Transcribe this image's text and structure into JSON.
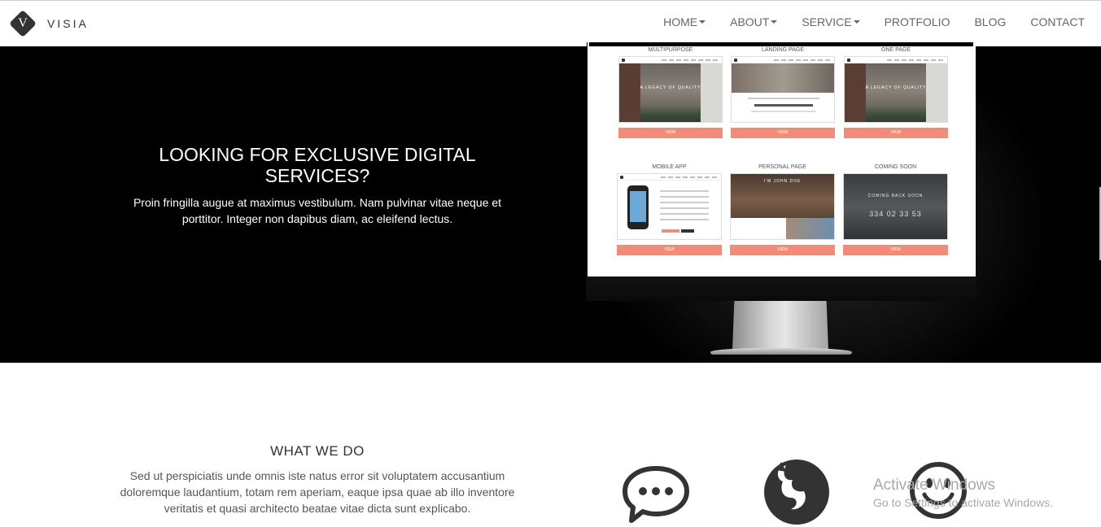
{
  "logo": {
    "letter": "V",
    "text": "VISIA"
  },
  "nav": {
    "items": [
      {
        "label": "HOME",
        "dropdown": true
      },
      {
        "label": "ABOUT",
        "dropdown": true
      },
      {
        "label": "SERVICE",
        "dropdown": true
      },
      {
        "label": "PROTFOLIO",
        "dropdown": false
      },
      {
        "label": "BLOG",
        "dropdown": false
      },
      {
        "label": "CONTACT",
        "dropdown": false
      }
    ]
  },
  "hero": {
    "title": "LOOKING FOR EXCLUSIVE DIGITAL SERVICES?",
    "text": "Proin fringilla augue at maximus vestibulum. Nam pulvinar vitae neque et porttitor. Integer non dapibus diam, ac eleifend lectus."
  },
  "monitor": {
    "tiles": [
      {
        "label": "MULTIPURPOSE",
        "button": "VIEW",
        "caption": "A LEGACY OF QUALITY"
      },
      {
        "label": "LANDING PAGE",
        "button": "VIEW",
        "caption": ""
      },
      {
        "label": "ONE PAGE",
        "button": "VIEW",
        "caption": "A LEGACY OF QUALITY"
      },
      {
        "label": "MOBILE APP",
        "button": "VIEW",
        "caption": ""
      },
      {
        "label": "PERSONAL PAGE",
        "button": "VIEW",
        "caption": "I'M JOHN DOE"
      },
      {
        "label": "COMING SOON",
        "button": "VIEW",
        "caption": "COMING BACK SOON",
        "countdown": "334  02  33  53"
      }
    ]
  },
  "what_we_do": {
    "title": "WHAT WE DO",
    "text": "Sed ut perspiciatis unde omnis iste natus error sit voluptatem accusantium doloremque laudantium, totam rem aperiam, eaque ipsa quae ab illo inventore veritatis et quasi architecto beatae vitae dicta sunt explicabo."
  },
  "icons": [
    "chat-icon",
    "firefox-icon",
    "smile-icon"
  ],
  "watermark": {
    "line1": "Activate Windows",
    "line2": "Go to Settings to activate Windows."
  }
}
